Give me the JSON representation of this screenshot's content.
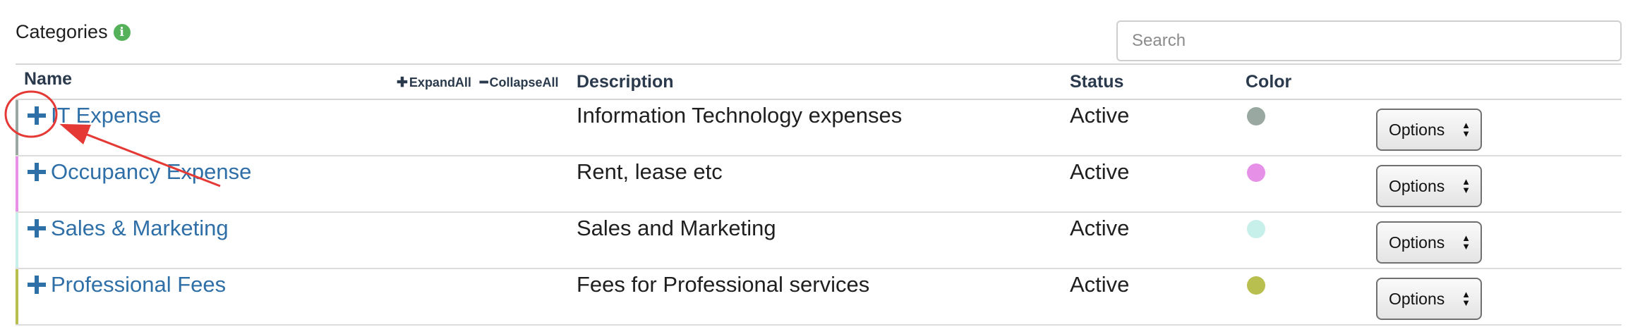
{
  "header": {
    "title": "Categories",
    "info_icon": "info-icon",
    "search_placeholder": "Search"
  },
  "table": {
    "columns": {
      "name": "Name",
      "description": "Description",
      "status": "Status",
      "color": "Color"
    },
    "expand_all": "ExpandAll",
    "collapse_all": "CollapseAll",
    "rows": [
      {
        "name": "IT Expense",
        "description": "Information Technology expenses",
        "status": "Active",
        "color": "#99a8a1",
        "options": "Options"
      },
      {
        "name": "Occupancy Expense",
        "description": "Rent, lease etc",
        "status": "Active",
        "color": "#e690e8",
        "options": "Options"
      },
      {
        "name": "Sales & Marketing",
        "description": "Sales and Marketing",
        "status": "Active",
        "color": "#c8f0ea",
        "options": "Options"
      },
      {
        "name": "Professional Fees",
        "description": "Fees for Professional services",
        "status": "Active",
        "color": "#b8bf4e",
        "options": "Options"
      }
    ]
  },
  "colors": {
    "link": "#2f6fa7",
    "annotation": "#e53935"
  }
}
